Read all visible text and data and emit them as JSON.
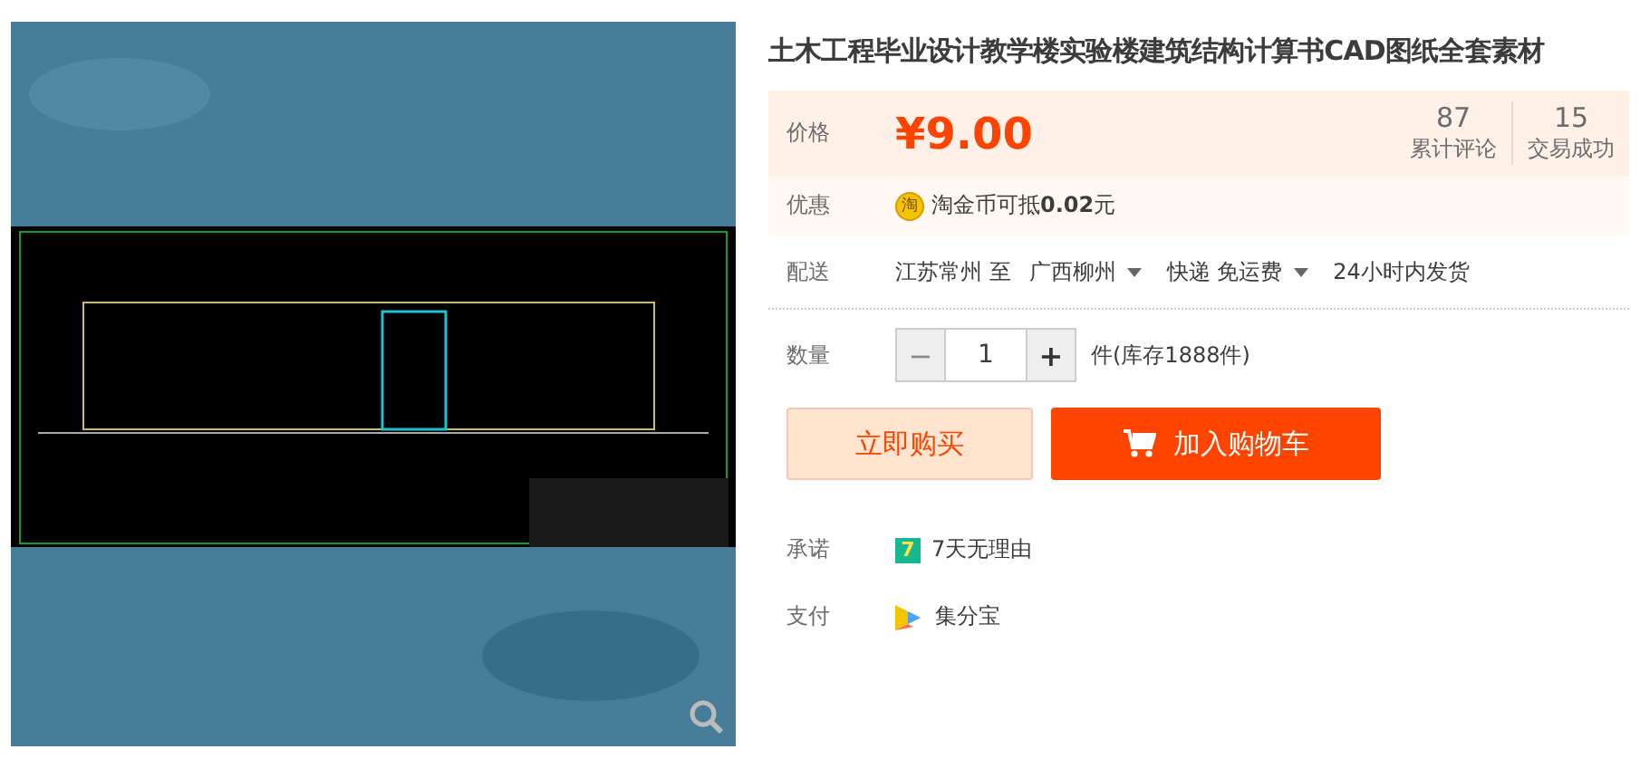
{
  "title": "土木工程毕业设计教学楼实验楼建筑结构计算书CAD图纸全套素材",
  "price": {
    "label": "价格",
    "value": "¥9.00"
  },
  "stats": [
    {
      "value": "87",
      "label": "累计评论"
    },
    {
      "value": "15",
      "label": "交易成功"
    }
  ],
  "promo": {
    "label": "优惠",
    "icon_text": "淘",
    "text": "淘金币可抵**0.02**元"
  },
  "delivery": {
    "label": "配送",
    "from": "江苏常州 至",
    "to": "广西柳州",
    "shipping": "快递 免运费",
    "dispatch": "24小时内发货"
  },
  "quantity": {
    "label": "数量",
    "minus_disabled": true,
    "minus": "−",
    "plus": "+",
    "value": "1",
    "unit": "件(库存1888件)"
  },
  "buttons": [
    {
      "kind": "buy",
      "label": "立即购买"
    },
    {
      "kind": "cart",
      "label": "加入购物车"
    }
  ],
  "services": [
    {
      "kind": "seven",
      "label": "承诺",
      "icon_text": "7",
      "text": "7天无理由"
    },
    {
      "kind": "pay",
      "label": "支付",
      "text": "集分宝"
    }
  ]
}
